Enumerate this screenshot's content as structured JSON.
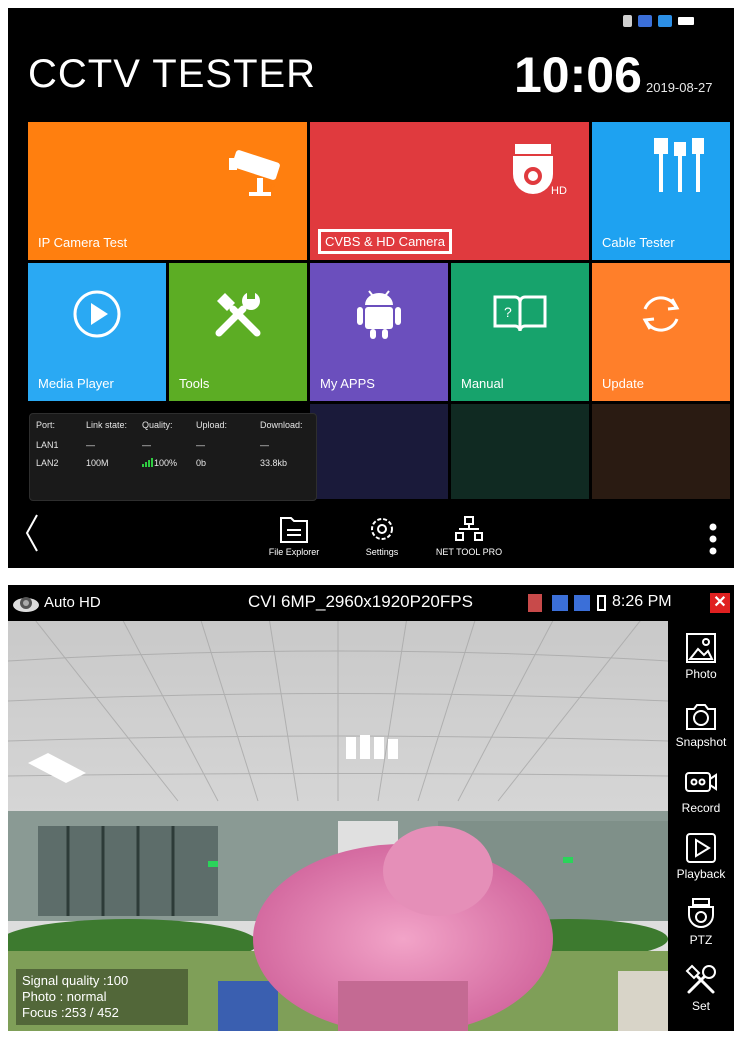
{
  "screen1": {
    "app_title": "CCTV TESTER",
    "time": "10:06",
    "date": "2019-08-27",
    "tiles": [
      {
        "label": "IP Camera Test",
        "color": "#ff7f0f"
      },
      {
        "label": "CVBS & HD Camera",
        "color": "#e03a3e"
      },
      {
        "label": "Cable Tester",
        "color": "#1ea2f1"
      },
      {
        "label": "Media Player",
        "color": "#2aa9f3"
      },
      {
        "label": "Tools",
        "color": "#5cad24"
      },
      {
        "label": "My APPS",
        "color": "#6b4fbd"
      },
      {
        "label": "Manual",
        "color": "#17a36c"
      },
      {
        "label": "Update",
        "color": "#ff7f2a"
      }
    ],
    "network": {
      "headers": [
        "Port:",
        "Link state:",
        "Quality:",
        "Upload:",
        "Download:"
      ],
      "rows": [
        [
          "LAN1",
          "—",
          "—",
          "—",
          "—"
        ],
        [
          "LAN2",
          "100M",
          "100%",
          "0b",
          "33.8kb"
        ]
      ]
    },
    "nav": {
      "back_icon": "chevron-left-icon",
      "file_explorer": "File Explorer",
      "settings": "Settings",
      "net_tool": "NET TOOL PRO",
      "menu_icon": "more-vertical-icon"
    }
  },
  "screen2": {
    "mode": "Auto HD",
    "resolution": "CVI 6MP_2960x1920P20FPS",
    "time": "8:26 PM",
    "side_buttons": [
      "Photo",
      "Snapshot",
      "Record",
      "Playback",
      "PTZ",
      "Set"
    ],
    "overlay": {
      "signal": "Signal quality :100",
      "photo": "Photo : normal",
      "focus": "Focus :253 / 452"
    }
  },
  "colors": {
    "highlight_border": "#ffffff",
    "close_red": "#e02020",
    "signal_green": "#2ecc40"
  }
}
